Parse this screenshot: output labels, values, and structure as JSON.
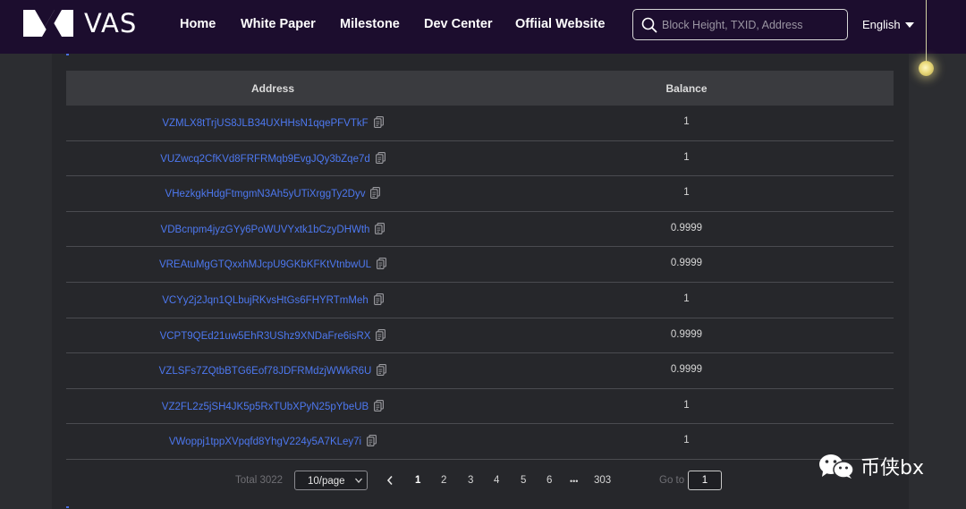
{
  "header": {
    "logo_text": "VAS",
    "nav": [
      "Home",
      "White Paper",
      "Milestone",
      "Dev Center",
      "Offiial Website"
    ],
    "search_placeholder": "Block Height, TXID, Address",
    "language": "English"
  },
  "table": {
    "columns": [
      "Address",
      "Balance"
    ],
    "rows": [
      {
        "address": "VZMLX8tTrjUS8JLB34UXHHsN1qqePFVTkF",
        "balance": "1"
      },
      {
        "address": "VUZwcq2CfKVd8FRFRMqb9EvgJQy3bZqe7d",
        "balance": "1"
      },
      {
        "address": "VHezkgkHdgFtmgmN3Ah5yUTiXrggTy2Dyv",
        "balance": "1"
      },
      {
        "address": "VDBcnpm4jyzGYy6PoWUVYxtk1bCzyDHWth",
        "balance": "0.9999"
      },
      {
        "address": "VREAtuMgGTQxxhMJcpU9GKbKFKtVtnbwUL",
        "balance": "0.9999"
      },
      {
        "address": "VCYy2j2Jqn1QLbujRKvsHtGs6FHYRTmMeh",
        "balance": "1"
      },
      {
        "address": "VCPT9QEd21uw5EhR3UShz9XNDaFre6isRX",
        "balance": "0.9999"
      },
      {
        "address": "VZLSFs7ZQtbBTG6Eof78JDFRMdzjWWkR6U",
        "balance": "0.9999"
      },
      {
        "address": "VZ2FL2z5jSH4JK5p5RxTUbXPyN25pYbeUB",
        "balance": "1"
      },
      {
        "address": "VWoppj1tppXVpqfd8YhgV224y5A7KLey7i",
        "balance": "1"
      }
    ]
  },
  "pagination": {
    "total": "Total 3022",
    "page_size": "10/page",
    "pages": [
      "1",
      "2",
      "3",
      "4",
      "5",
      "6"
    ],
    "ellipsis": "•••",
    "last_page": "303",
    "goto_label": "Go to",
    "goto_value": "1",
    "current_page": "1"
  },
  "watermark": {
    "text": "币侠bx"
  },
  "colors": {
    "header_bg": "#1c0d2e",
    "page_bg": "#2c2d31",
    "panel_bg": "#26272b",
    "table_header_bg": "#3a3b3f",
    "link": "#4d78f0"
  }
}
